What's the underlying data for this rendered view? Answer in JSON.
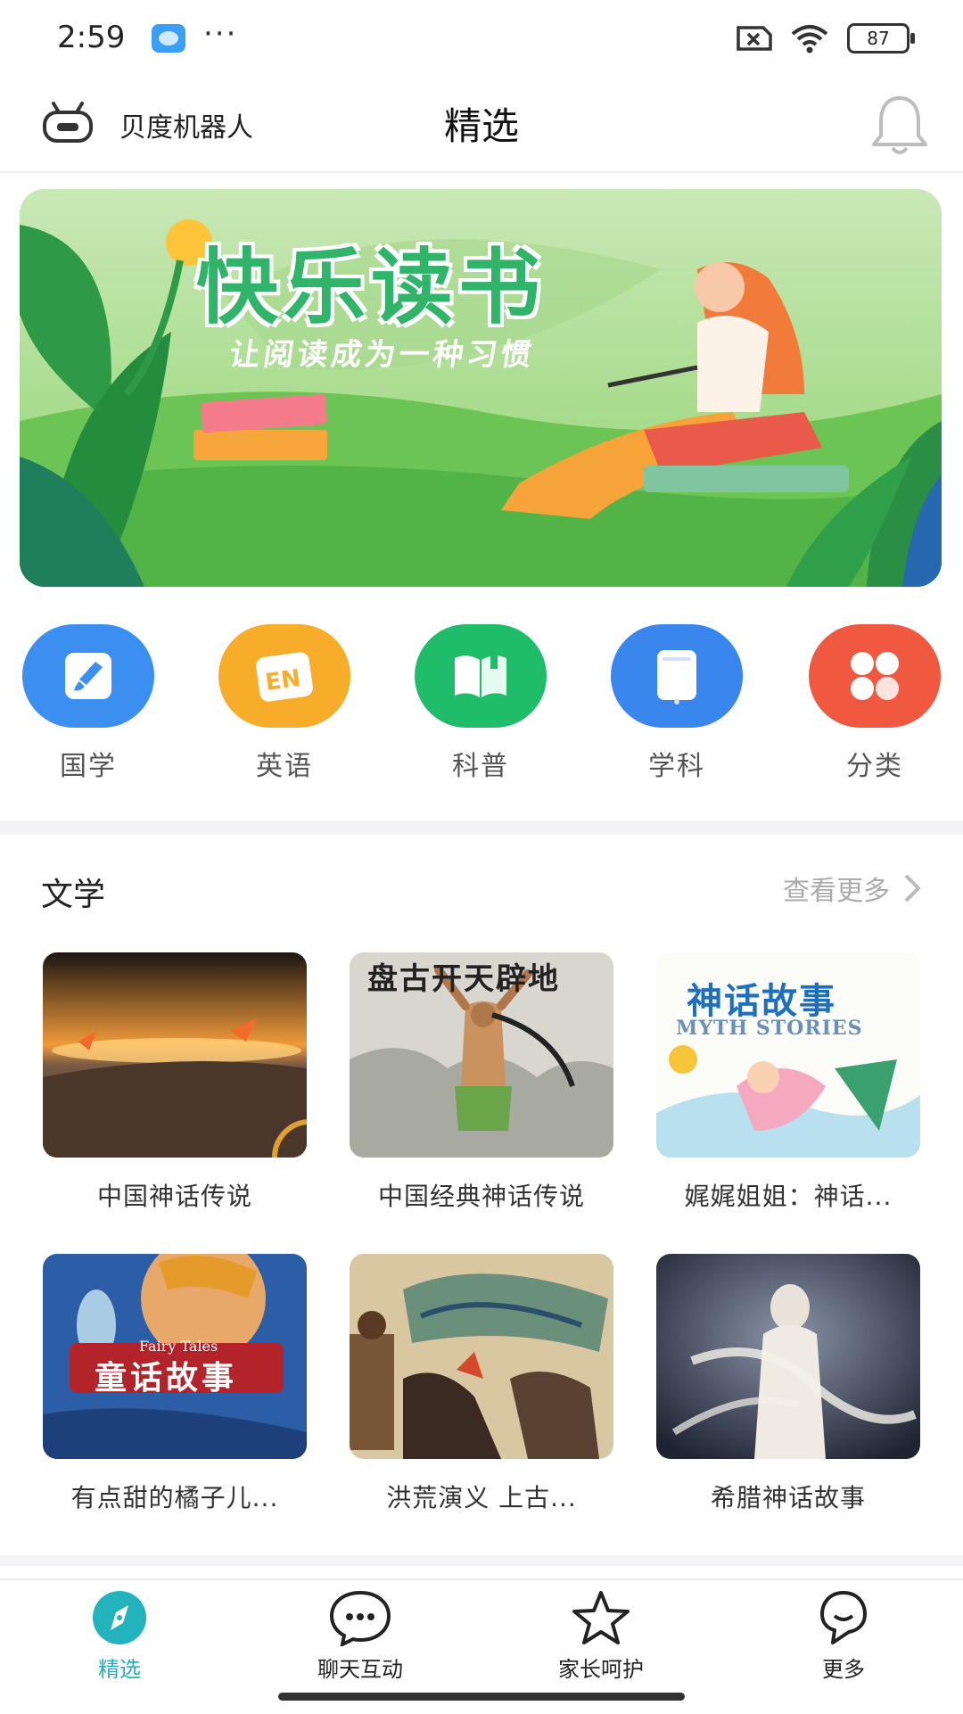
{
  "status_bar": {
    "time": "2:59",
    "dots": "···",
    "battery": "87"
  },
  "header": {
    "app_name": "贝度机器人",
    "title": "精选"
  },
  "banner": {
    "title": "快乐读书",
    "subtitle": "让阅读成为一种习惯"
  },
  "categories": [
    {
      "label": "国学",
      "icon": "brush-icon",
      "color": "#3b8ff0"
    },
    {
      "label": "英语",
      "icon": "en-card-icon",
      "color": "#f7ad2a"
    },
    {
      "label": "科普",
      "icon": "open-book-icon",
      "color": "#1fbd6a"
    },
    {
      "label": "学科",
      "icon": "tablet-icon",
      "color": "#3a86ef"
    },
    {
      "label": "分类",
      "icon": "grid-icon",
      "color": "#f0593f"
    }
  ],
  "section": {
    "title": "文学",
    "see_more": "查看更多"
  },
  "books": [
    {
      "title": "中国神话传说"
    },
    {
      "title": "中国经典神话传说",
      "cover_text": "盘古开天辟地"
    },
    {
      "title": "娓娓姐姐：神话...",
      "cover_text": "神话故事",
      "cover_subtext": "MYTH STORIES"
    },
    {
      "title": "有点甜的橘子儿...",
      "cover_text": "童话故事",
      "cover_subtext": "Fairy Tales"
    },
    {
      "title": "洪荒演义 上古..."
    },
    {
      "title": "希腊神话故事"
    }
  ],
  "bottom_nav": [
    {
      "label": "精选",
      "icon": "compass-icon",
      "active": true
    },
    {
      "label": "聊天互动",
      "icon": "chat-icon",
      "active": false
    },
    {
      "label": "家长呵护",
      "icon": "star-icon",
      "active": false
    },
    {
      "label": "更多",
      "icon": "more-face-icon",
      "active": false
    }
  ],
  "colors": {
    "accent": "#22b3bd",
    "banner_green": "#5cbf5a"
  }
}
